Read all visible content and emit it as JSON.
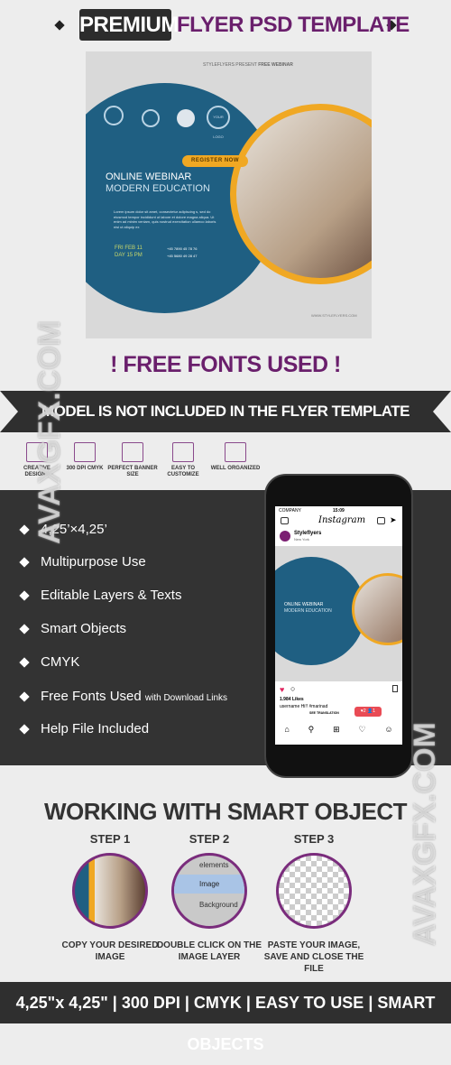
{
  "header": {
    "premium": "PREMIUM",
    "rest": "FLYER PSD TEMPLATE"
  },
  "flyer": {
    "present": "STYLEFLYERS PRESENT",
    "free_webinar": "FREE WEBINAR",
    "logo": "YOUR LOGO",
    "register": "REGISTER NOW",
    "title1": "ONLINE WEBINAR",
    "title2": "MODERN EDUCATION",
    "body": "Lorem ipsum dolor sit amet, consectetur adipiscing s, sed do eiusmod tempor incididunt ut labore et dolore magna aliqua. Ut enim ad minim veniam, quis nostrud exercitation ullamco laboris nisi ut aliquip ex",
    "date1": "FRI FEB 11",
    "date2": "DAY 15 PM",
    "phone1": "+45 7890 45 78 76",
    "phone2": "+45 5680 49 28 47",
    "website": "WWW.STYLEFLYERS.COM",
    "accent": "#f0a823",
    "blue": "#1f5f82"
  },
  "free_fonts": "! FREE FONTS USED !",
  "banner": "MODEL IS NOT INCLUDED  IN THE FLYER TEMPLATE",
  "features": [
    {
      "icon": "diamond-icon",
      "label": "CREATIVE DESIGNS"
    },
    {
      "icon": "grid-icon",
      "label": "300 DPI CMYK"
    },
    {
      "icon": "image-icon",
      "label": "PERFECT BANNER SIZE"
    },
    {
      "icon": "pencil-ruler-icon",
      "label": "EASY TO CUSTOMIZE"
    },
    {
      "icon": "layers-icon",
      "label": "WELL ORGANIZED"
    }
  ],
  "bullets": [
    "4,25’×4,25’",
    "Multipurpose Use",
    "Editable Layers & Texts",
    "Smart Objects",
    "CMYK",
    "Free Fonts Used",
    "Help File Included"
  ],
  "bullet_small": "with Download Links",
  "phone": {
    "carrier": "COMPANY",
    "time": "15:09",
    "app": "Instagram",
    "account": "Styleflyers",
    "location": "New York",
    "likes": "1.984 Likes",
    "caption": "username Hi!! #marinad",
    "see_translation": "SEE TRANSLATION",
    "notif_comments": "2",
    "notif_follows": "1"
  },
  "working_title": "WORKING WITH SMART OBJECT",
  "steps": [
    {
      "title": "STEP 1",
      "caption": "COPY YOUR DESIRED IMAGE"
    },
    {
      "title": "STEP 2",
      "caption": "DOUBLE CLICK ON THE IMAGE LAYER",
      "layers": [
        "elements",
        "Image",
        "Background"
      ]
    },
    {
      "title": "STEP 3",
      "caption": "PASTE YOUR IMAGE, SAVE AND CLOSE THE FILE"
    }
  ],
  "bottom_bar": "4,25\"x 4,25\"  |  300 DPI  |  CMYK  |  EASY TO USE  |  SMART OBJECTS",
  "watermark": "AVAXGFX.COM",
  "colors": {
    "purple": "#6a1f6c",
    "dark": "#2f2f2f",
    "background": "#ededed"
  }
}
